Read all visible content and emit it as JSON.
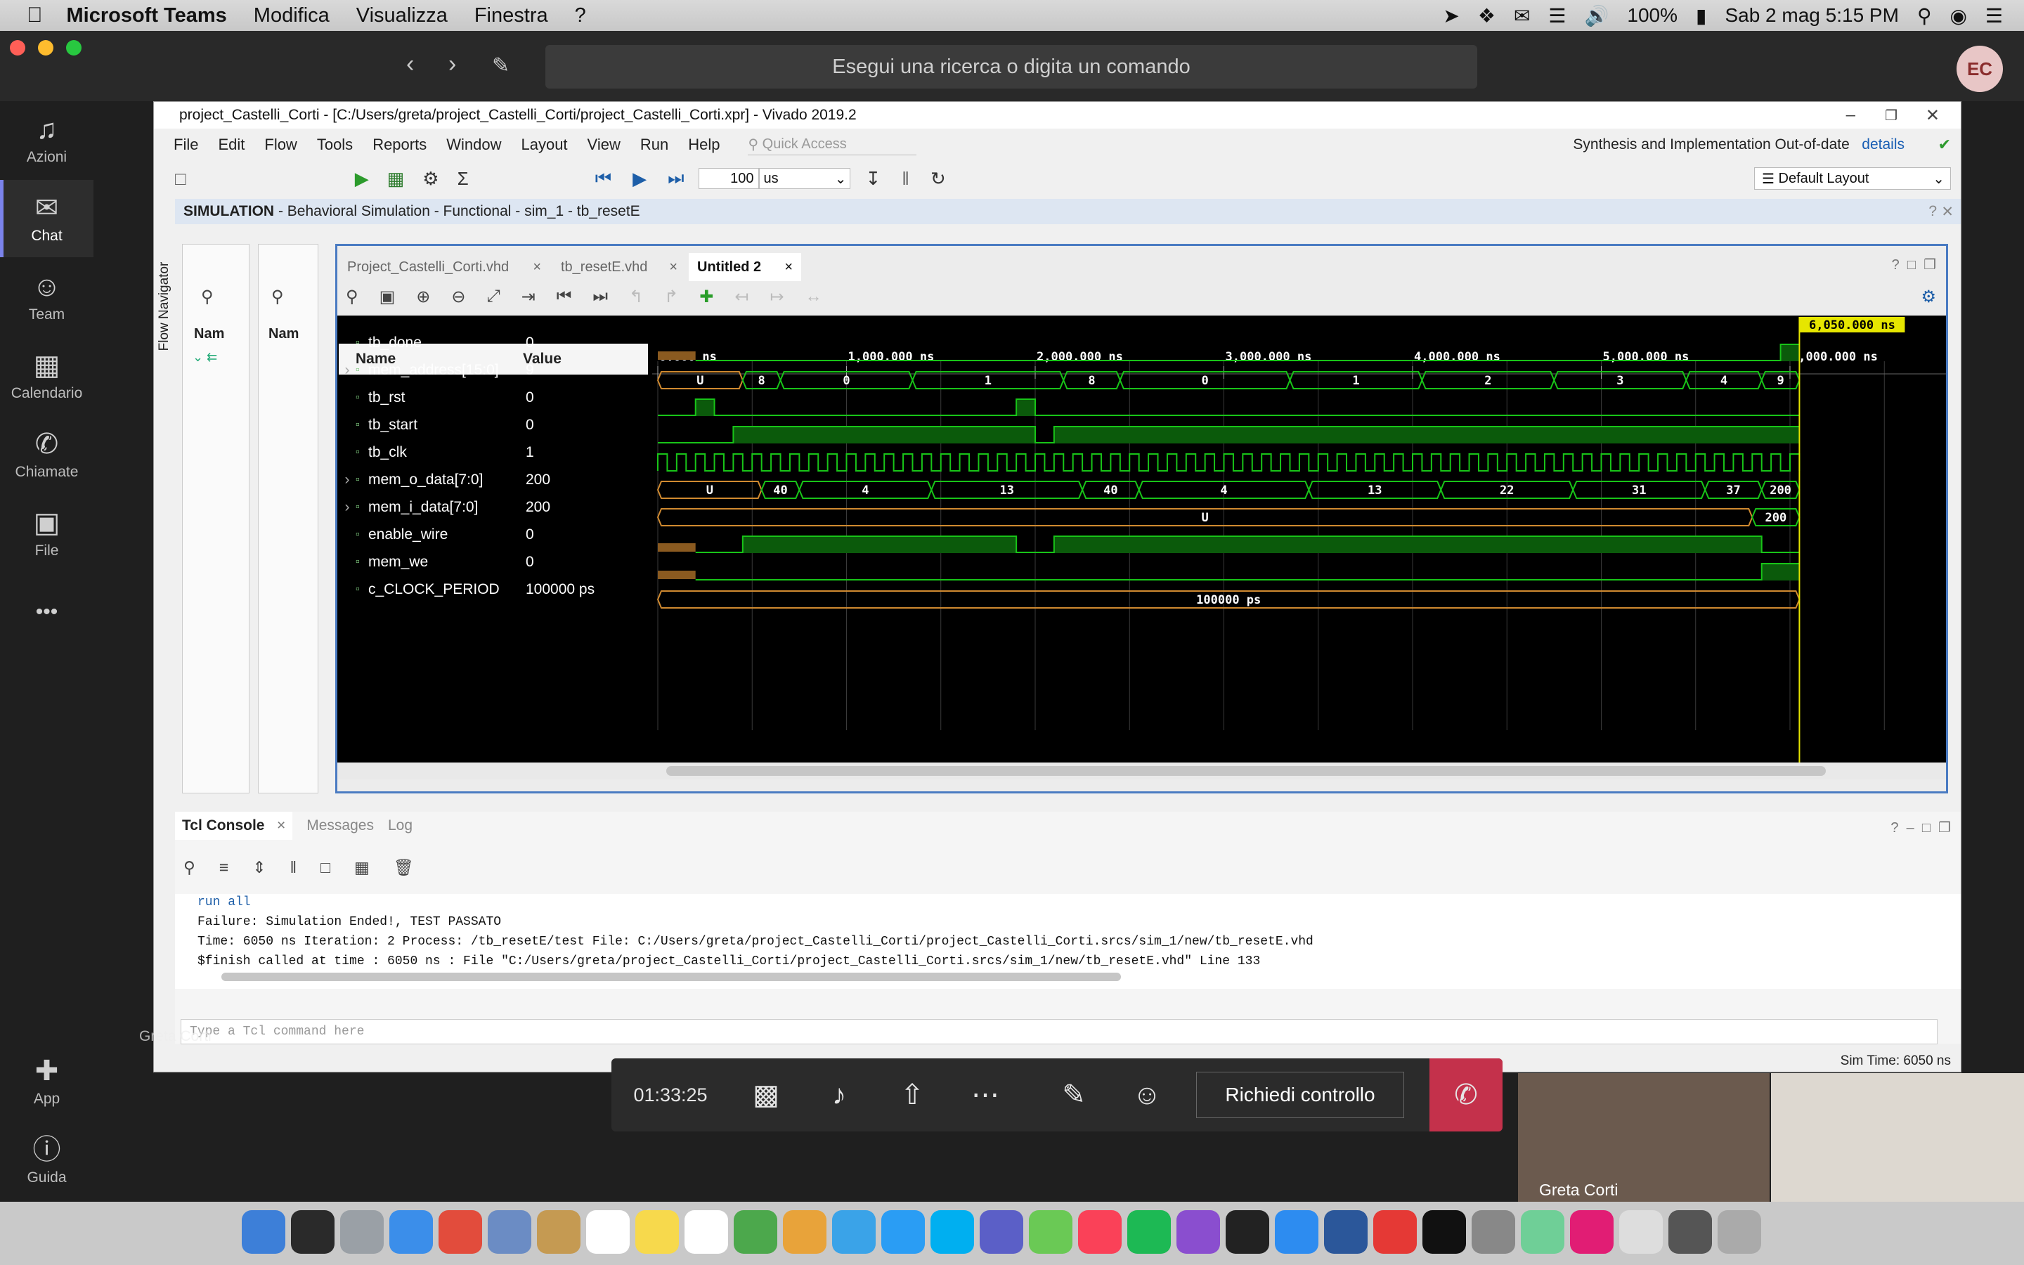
{
  "menubar": {
    "app": "Microsoft Teams",
    "items": [
      "Modifica",
      "Visualizza",
      "Finestra",
      "?"
    ],
    "battery": "100%",
    "datetime": "Sab 2 mag  5:15 PM"
  },
  "teams": {
    "search_placeholder": "Esegui una ricerca o digita un comando",
    "avatar": "EC",
    "rail": [
      "Azioni",
      "Chat",
      "Team",
      "Calendario",
      "Chiamate",
      "File"
    ],
    "rail_bottom": [
      "App",
      "Guida"
    ]
  },
  "vivado": {
    "title": "project_Castelli_Corti - [C:/Users/greta/project_Castelli_Corti/project_Castelli_Corti.xpr] - Vivado 2019.2",
    "menus": [
      "File",
      "Edit",
      "Flow",
      "Tools",
      "Reports",
      "Window",
      "Layout",
      "View",
      "Run",
      "Help"
    ],
    "quick_access": "Quick Access",
    "status_msg": "Synthesis and Implementation Out-of-date",
    "details": "details",
    "run_time": "100",
    "run_unit": "us",
    "layout": "Default Layout",
    "sim_label": "SIMULATION",
    "sim_desc": "- Behavioral Simulation - Functional - sim_1 - tb_resetE",
    "flow_navigator": "Flow Navigator",
    "scope_name": "Nam",
    "objects_name": "Nam",
    "tabs": [
      "Project_Castelli_Corti.vhd",
      "tb_resetE.vhd",
      "Untitled 2"
    ],
    "col_name": "Name",
    "col_value": "Value",
    "cursor_label": "6,050.000 ns",
    "time_ticks": [
      "0.000 ns",
      "1,000.000 ns",
      "2,000.000 ns",
      "3,000.000 ns",
      "4,000.000 ns",
      "5,000.000 ns",
      "6,000.000 ns"
    ],
    "signals": [
      {
        "name": "tb_done",
        "value": "0"
      },
      {
        "name": "mem_address[15:0]",
        "value": "9"
      },
      {
        "name": "tb_rst",
        "value": "0"
      },
      {
        "name": "tb_start",
        "value": "0"
      },
      {
        "name": "tb_clk",
        "value": "1"
      },
      {
        "name": "mem_o_data[7:0]",
        "value": "200"
      },
      {
        "name": "mem_i_data[7:0]",
        "value": "200"
      },
      {
        "name": "enable_wire",
        "value": "0"
      },
      {
        "name": "mem_we",
        "value": "0"
      },
      {
        "name": "c_CLOCK_PERIOD",
        "value": "100000 ps"
      }
    ],
    "bus_addr": [
      "U",
      "8",
      "0",
      "1",
      "8",
      "0",
      "1",
      "2",
      "3",
      "4",
      "9"
    ],
    "bus_odata": [
      "U",
      "40",
      "4",
      "13",
      "40",
      "4",
      "13",
      "22",
      "31",
      "37",
      "200"
    ],
    "bus_idata": [
      "U",
      "200"
    ],
    "period_label": "100000 ps",
    "console_tabs": [
      "Tcl Console",
      "Messages",
      "Log"
    ],
    "console_lines": [
      "run all",
      "Failure: Simulation Ended!, TEST PASSATO",
      "Time: 6050 ns  Iteration: 2  Process: /tb_resetE/test  File: C:/Users/greta/project_Castelli_Corti/project_Castelli_Corti.srcs/sim_1/new/tb_resetE.vhd",
      "$finish called at time : 6050 ns : File \"C:/Users/greta/project_Castelli_Corti/project_Castelli_Corti.srcs/sim_1/new/tb_resetE.vhd\" Line 133"
    ],
    "tcl_placeholder": "Type a Tcl command here",
    "sim_time": "Sim Time: 6050 ns",
    "presenter": "Greta Corti"
  },
  "call": {
    "timer": "01:33:25",
    "request_control": "Richiedi controllo",
    "participant": "Greta Corti"
  },
  "colors": {
    "wave_green": "#00a000",
    "wave_fill": "#0b5a0b",
    "cursor": "#e6e600",
    "teams_accent": "#7b83eb",
    "hangup": "#c4314b"
  }
}
